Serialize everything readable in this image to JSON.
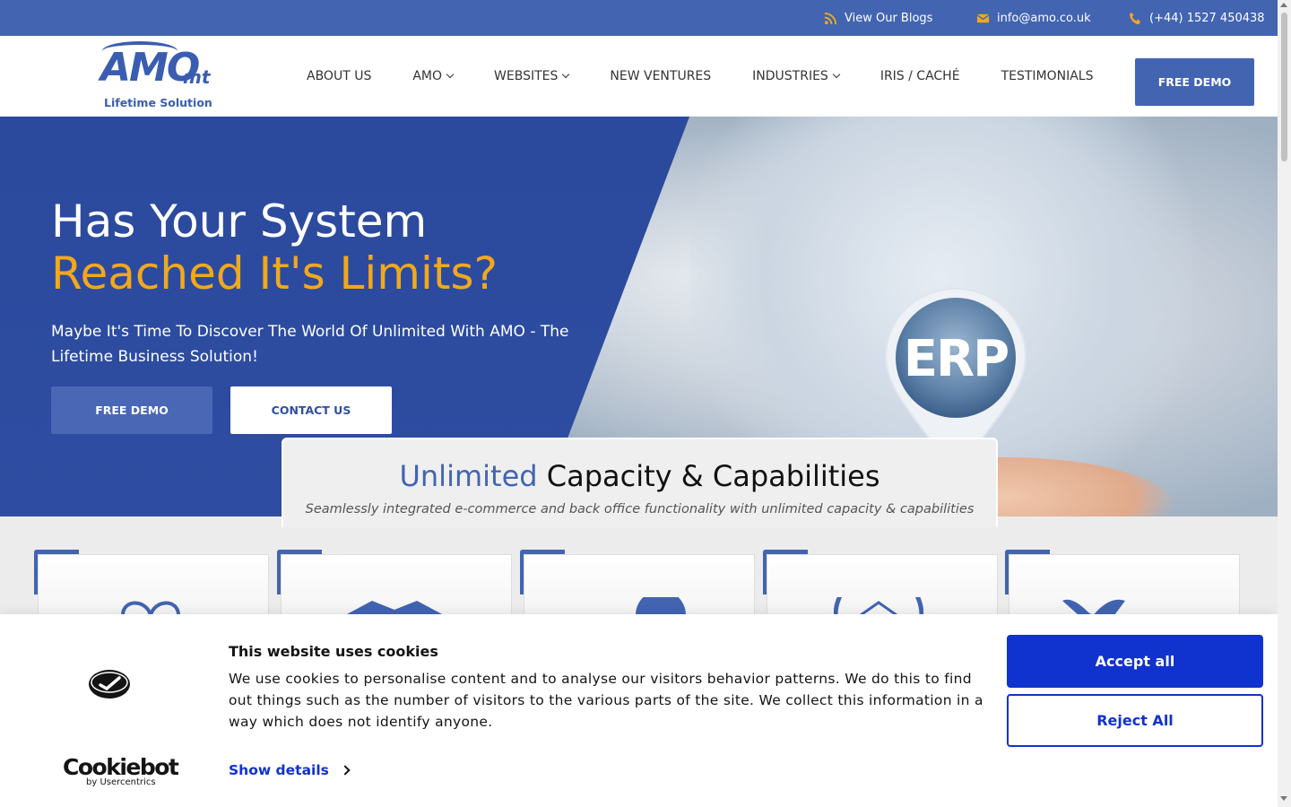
{
  "topbar": {
    "blogs": "View Our Blogs",
    "email": "info@amo.co.uk",
    "phone": "(+44) 1527 450438",
    "accent_icon_color": "#f2a81d"
  },
  "logo": {
    "main": "AMO",
    "suffix": "mt",
    "tagline": "Lifetime Solution"
  },
  "nav": {
    "items": [
      {
        "label": "ABOUT US",
        "dropdown": false
      },
      {
        "label": "AMO",
        "dropdown": true
      },
      {
        "label": "WEBSITES",
        "dropdown": true
      },
      {
        "label": "NEW VENTURES",
        "dropdown": false
      },
      {
        "label": "INDUSTRIES",
        "dropdown": true
      },
      {
        "label": "IRIS / CACHÉ",
        "dropdown": false
      },
      {
        "label": "TESTIMONIALS",
        "dropdown": false
      }
    ],
    "cta": "FREE DEMO"
  },
  "hero": {
    "title_line1": "Has Your System",
    "title_line2": "Reached It's Limits?",
    "subtitle": "Maybe It's Time To Discover The World Of Unlimited With AMO - The Lifetime Business Solution!",
    "btn_demo": "FREE DEMO",
    "btn_contact": "CONTACT US",
    "pin_text": "ERP",
    "colors": {
      "primary": "#2f4ea3",
      "accent": "#f2a81d"
    }
  },
  "capacity": {
    "title_highlight": "Unlimited",
    "title_rest": " Capacity & Capabilities",
    "subtitle": "Seamlessly integrated e-commerce and back office functionality with unlimited capacity & capabilities"
  },
  "cookie": {
    "title": "This website uses cookies",
    "text": "We use cookies to personalise content and to analyse our visitors behavior patterns. We do this to find out things such as the number of visitors to the various parts of the site. We collect this information in a way which does not identify anyone.",
    "show_details": "Show details",
    "accept": "Accept all",
    "reject": "Reject All",
    "brand": "Cookiebot",
    "brand_sub": "by Usercentrics",
    "brand_color": "#1032cf"
  }
}
